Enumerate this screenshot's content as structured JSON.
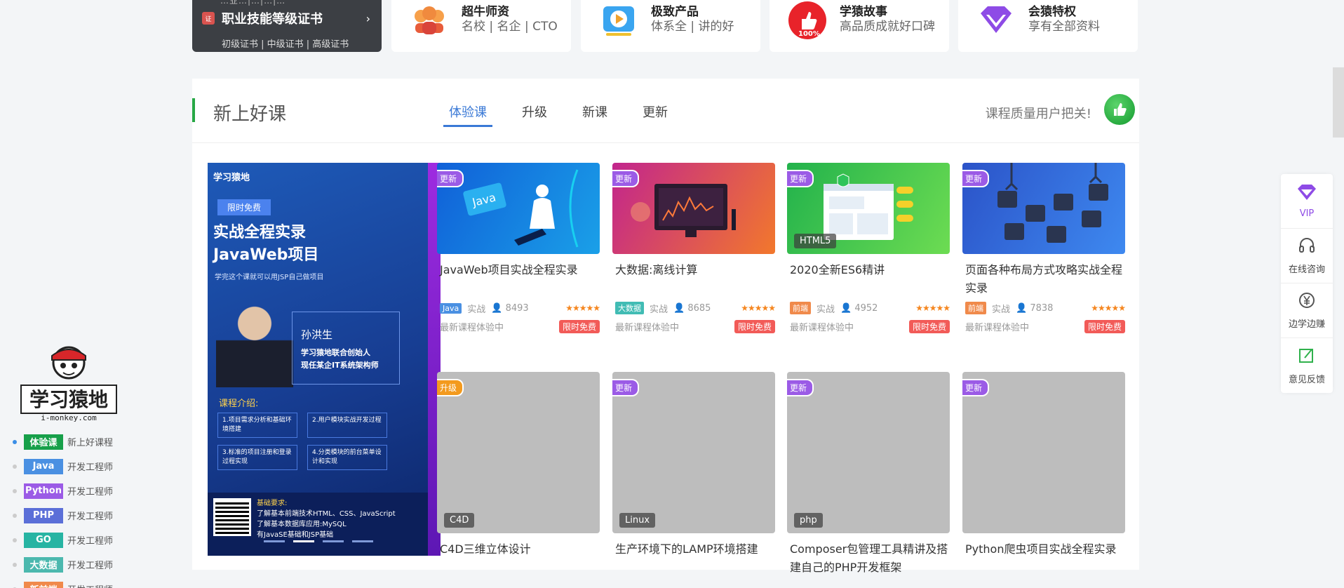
{
  "top": {
    "cert": {
      "topline": "…业…|…|…|…",
      "title": "职业技能等级证书",
      "arrow": "›",
      "sub": "初级证书 | 中级证书 | 高级证书"
    },
    "features": [
      {
        "title": "超牛师资",
        "sub": "名校 | 名企 | CTO",
        "icon": "teachers-icon"
      },
      {
        "title": "极致产品",
        "sub": "体系全 | 讲的好",
        "icon": "video-play-icon"
      },
      {
        "title": "学猿故事",
        "sub": "高品质成就好口碑",
        "icon": "thumbs-up-100-icon"
      },
      {
        "title": "会猿特权",
        "sub": "享有全部资料",
        "icon": "diamond-icon"
      }
    ]
  },
  "section": {
    "title": "新上好课",
    "tabs": [
      "体验课",
      "升级",
      "新课",
      "更新"
    ],
    "active_tab": 0,
    "slogan": "课程质量用户把关!"
  },
  "banner": {
    "logo": "学习猿地",
    "tag": "限时免费",
    "headline1": "实战全程实录",
    "headline2": "JavaWeb项目",
    "subline": "学完这个课就可以用JSP自己做项目",
    "teacher": "孙洪生",
    "role1": "学习猿地联合创始人",
    "role2": "现任某企IT系统架构师",
    "intro_title": "课程介绍:",
    "boxes": [
      "1.项目需求分析和基础环境搭建",
      "2.用户模块实战开发过程",
      "3.标准的项目注册和登录过程实现",
      "4.分类模块的前台菜单设计和实现"
    ],
    "req_title": "基础要求:",
    "req1": "了解基本前端技术HTML、CSS、JavaScript",
    "req2": "了解基本数据库应用:MySQL",
    "req3": "有JavaSE基础和JSP基础"
  },
  "cards_row1": [
    {
      "badge": "更新",
      "title": "JavaWeb项目实战全程实录",
      "lang": "Java",
      "lang_color": "#4a90e2",
      "level": "实战",
      "students": "8493",
      "stars": "★★★★★",
      "status": "最新课程体验中",
      "free": "限时免费",
      "chip": "",
      "img_colors": "#1060d8,#1aa0e8"
    },
    {
      "badge": "更新",
      "title": "大数据:离线计算",
      "lang": "大数据",
      "lang_color": "#41bcb4",
      "level": "实战",
      "students": "8685",
      "stars": "★★★★★",
      "status": "最新课程体验中",
      "free": "限时免费",
      "chip": "",
      "img_colors": "#c2258d,#f2782c"
    },
    {
      "badge": "更新",
      "title": "2020全新ES6精讲",
      "lang": "前端",
      "lang_color": "#f08a4b",
      "level": "实战",
      "students": "4952",
      "stars": "★★★★★",
      "status": "最新课程体验中",
      "free": "限时免费",
      "chip": "HTML5",
      "img_colors": "#22b24c,#6ddc52"
    },
    {
      "badge": "更新",
      "title": "页面各种布局方式攻略实战全程实录",
      "lang": "前端",
      "lang_color": "#f08a4b",
      "level": "实战",
      "students": "7838",
      "stars": "★★★★★",
      "status": "最新课程体验中",
      "free": "限时免费",
      "chip": "",
      "img_colors": "#2b53c8,#3e89f0"
    }
  ],
  "cards_row2": [
    {
      "badge": "升级",
      "badge_style": "o",
      "chip": "C4D",
      "title": "C4D三维立体设计"
    },
    {
      "badge": "更新",
      "badge_style": "p",
      "chip": "Linux",
      "title": "生产环境下的LAMP环境搭建"
    },
    {
      "badge": "更新",
      "badge_style": "p",
      "chip": "php",
      "title": "Composer包管理工具精讲及搭建自己的PHP开发框架"
    },
    {
      "badge": "更新",
      "badge_style": "p",
      "chip": "",
      "title": "Python爬虫项目实战全程实录"
    }
  ],
  "left_nav": {
    "logo_text": "学习猿地",
    "logo_domain": "i-monkey.com",
    "items": [
      {
        "tag": "体验课",
        "color": "#17a04a",
        "text": "新上好课程"
      },
      {
        "tag": "Java",
        "color": "#4a90e2",
        "text": "开发工程师"
      },
      {
        "tag": "Python",
        "color": "#9b5be6",
        "text": "开发工程师"
      },
      {
        "tag": "PHP",
        "color": "#5b6fd8",
        "text": "开发工程师"
      },
      {
        "tag": "GO",
        "color": "#27b4a3",
        "text": "开发工程师"
      },
      {
        "tag": "大数据",
        "color": "#4bb8ae",
        "text": "开发工程师"
      },
      {
        "tag": "新前端",
        "color": "#f08a4b",
        "text": "开发工程师"
      }
    ]
  },
  "right_float": {
    "items": [
      {
        "label": "VIP",
        "icon": "vip-diamond-icon"
      },
      {
        "label": "在线咨询",
        "icon": "headset-icon"
      },
      {
        "label": "边学边赚",
        "icon": "yen-coin-icon"
      },
      {
        "label": "意见反馈",
        "icon": "edit-feedback-icon"
      }
    ]
  }
}
